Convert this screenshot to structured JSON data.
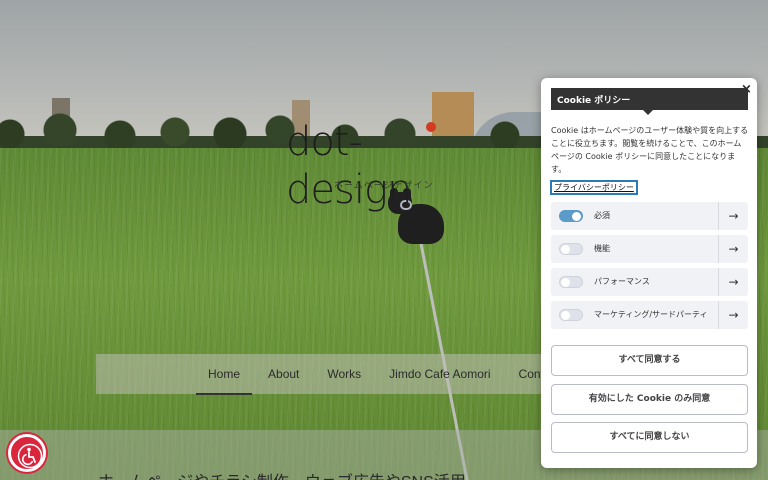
{
  "site": {
    "logo_text": "dot-design",
    "logo_subtitle": "ホームページデザイン",
    "tagline": "ホームページやチラシ制作、ウェブ広告やSNS活用"
  },
  "nav": {
    "items": [
      {
        "label": "Home",
        "active": true
      },
      {
        "label": "About"
      },
      {
        "label": "Works"
      },
      {
        "label": "Jimdo Cafe Aomori"
      },
      {
        "label": "Contac"
      }
    ]
  },
  "cookie": {
    "title": "Cookie ポリシー",
    "description": "Cookie はホームページのユーザー体験や質を向上することに役立ちます。閲覧を続けることで、このホームページの Cookie ポリシーに同意したことになります。",
    "privacy_link": "プライバシーポリシー",
    "categories": [
      {
        "label": "必須",
        "enabled": true
      },
      {
        "label": "機能",
        "enabled": false
      },
      {
        "label": "パフォーマンス",
        "enabled": false
      },
      {
        "label": "マーケティング/サードパーティ",
        "enabled": false
      }
    ],
    "buttons": {
      "accept_all": "すべて同意する",
      "accept_selected": "有効にした Cookie のみ同意",
      "reject_all": "すべてに同意しない"
    },
    "close_symbol": "×",
    "arrow_symbol": "→"
  },
  "colors": {
    "accessibility_button": "#d9263c",
    "toggle_on": "#5b9bc9",
    "logo_dot": "#d23a22"
  },
  "icons": {
    "accessibility": "wheelchair-icon",
    "close": "close-icon",
    "arrow": "arrow-right-icon"
  }
}
